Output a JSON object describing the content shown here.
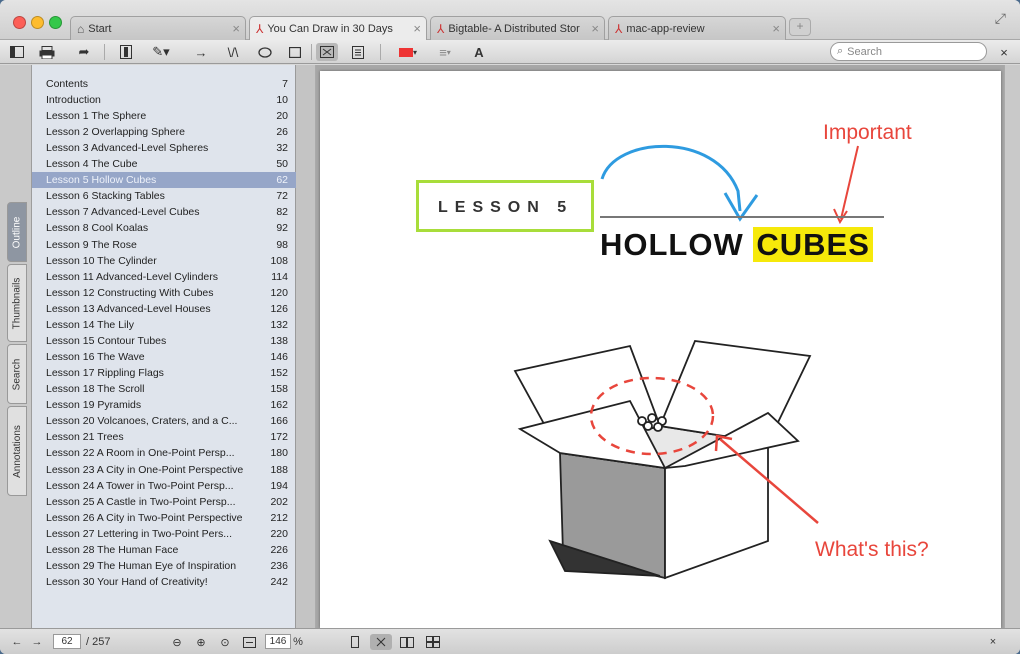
{
  "colors": {
    "accent_red": "#e8463c",
    "lesson_box": "#a8dd3a",
    "highlight": "#f6e90a",
    "arrow_blue": "#2e9be0",
    "selected_row": "#96a6c8"
  },
  "tabs": [
    {
      "label": "Start",
      "icon": "home-icon"
    },
    {
      "label": "You Can Draw in 30 Days",
      "icon": "pdf-icon",
      "active": true
    },
    {
      "label": "Bigtable- A Distributed Stor",
      "icon": "pdf-icon"
    },
    {
      "label": "mac-app-review",
      "icon": "pdf-icon"
    }
  ],
  "toolbar": {
    "search_placeholder": "Search",
    "icons": [
      "sidebar-icon",
      "print-icon",
      "share-icon",
      "text-select-icon",
      "pen-icon",
      "arrow-tool-icon",
      "freehand-icon",
      "ellipse-icon",
      "rectangle-icon",
      "fit-page-icon",
      "single-page-icon",
      "color-icon",
      "line-style-icon",
      "font-icon"
    ]
  },
  "side_tabs": [
    "Outline",
    "Thumbnails",
    "Search",
    "Annotations"
  ],
  "outline": [
    {
      "label": "Contents",
      "page": "7"
    },
    {
      "label": "Introduction",
      "page": "10"
    },
    {
      "label": "Lesson 1 The Sphere",
      "page": "20"
    },
    {
      "label": "Lesson 2 Overlapping Sphere",
      "page": "26"
    },
    {
      "label": "Lesson 3 Advanced-Level Spheres",
      "page": "32"
    },
    {
      "label": "Lesson 4 The Cube",
      "page": "50"
    },
    {
      "label": "Lesson 5 Hollow Cubes",
      "page": "62",
      "selected": true
    },
    {
      "label": "Lesson 6 Stacking Tables",
      "page": "72"
    },
    {
      "label": "Lesson 7 Advanced-Level Cubes",
      "page": "82"
    },
    {
      "label": "Lesson 8 Cool Koalas",
      "page": "92"
    },
    {
      "label": "Lesson 9 The Rose",
      "page": "98"
    },
    {
      "label": "Lesson 10 The Cylinder",
      "page": "108"
    },
    {
      "label": "Lesson 11 Advanced-Level Cylinders",
      "page": "114"
    },
    {
      "label": "Lesson 12 Constructing With Cubes",
      "page": "120"
    },
    {
      "label": "Lesson 13 Advanced-Level Houses",
      "page": "126"
    },
    {
      "label": "Lesson 14 The Lily",
      "page": "132"
    },
    {
      "label": "Lesson 15 Contour Tubes",
      "page": "138"
    },
    {
      "label": "Lesson 16 The Wave",
      "page": "146"
    },
    {
      "label": "Lesson 17 Rippling Flags",
      "page": "152"
    },
    {
      "label": "Lesson 18 The Scroll",
      "page": "158"
    },
    {
      "label": "Lesson 19 Pyramids",
      "page": "162"
    },
    {
      "label": "Lesson 20 Volcanoes, Craters, and a C...",
      "page": "166"
    },
    {
      "label": "Lesson 21 Trees",
      "page": "172"
    },
    {
      "label": "Lesson 22 A Room in One-Point Persp...",
      "page": "180"
    },
    {
      "label": "Lesson 23 A City in One-Point Perspective",
      "page": "188"
    },
    {
      "label": "Lesson 24 A Tower in Two-Point Persp...",
      "page": "194"
    },
    {
      "label": "Lesson 25 A Castle in Two-Point Persp...",
      "page": "202"
    },
    {
      "label": "Lesson 26 A City in Two-Point Perspective",
      "page": "212"
    },
    {
      "label": "Lesson 27 Lettering in Two-Point Pers...",
      "page": "220"
    },
    {
      "label": "Lesson 28 The Human Face",
      "page": "226"
    },
    {
      "label": "Lesson 29 The Human Eye of Inspiration",
      "page": "236"
    },
    {
      "label": "Lesson 30 Your Hand of Creativity!",
      "page": "242"
    }
  ],
  "document": {
    "lesson_label": "LESSON 5",
    "title_part1": "HOLLOW",
    "title_part2": "CUBES",
    "annotation_important": "Important",
    "annotation_whats_this": "What's this?"
  },
  "status": {
    "current_page": "62",
    "total_pages": "/ 257",
    "zoom": "146",
    "zoom_unit": "%"
  }
}
